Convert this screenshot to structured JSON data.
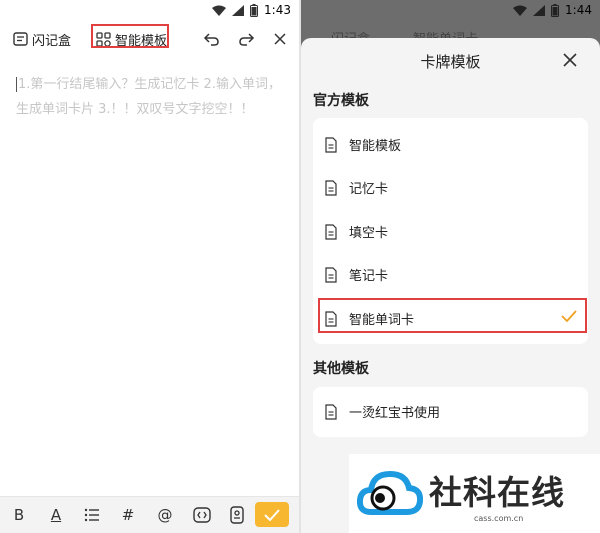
{
  "status": {
    "left_time": "1:43",
    "right_time": "1:44"
  },
  "editor": {
    "deck_label": "闪记盒",
    "template_label": "智能模板",
    "placeholder_text": "1.第一行结尾输入？生成记忆卡 2.输入单词，生成单词卡片 3.！！双叹号文字挖空！！"
  },
  "bottom_toolbar": {
    "bold": "B",
    "underline": "A",
    "hash": "#",
    "at": "@"
  },
  "behind": {
    "deck_label": "闪记盒",
    "template_label": "智能单词卡"
  },
  "sheet": {
    "title": "卡牌模板",
    "official_label": "官方模板",
    "official_items": [
      "智能模板",
      "记忆卡",
      "填空卡",
      "笔记卡",
      "智能单词卡"
    ],
    "other_label": "其他模板",
    "other_items": [
      "一烫红宝书使用"
    ]
  },
  "watermark": {
    "brand": "社科在线",
    "url": "cass.com.cn"
  },
  "colors": {
    "accent": "#f7b731",
    "highlight": "#e04040",
    "overlay": "#6d6d6d"
  }
}
